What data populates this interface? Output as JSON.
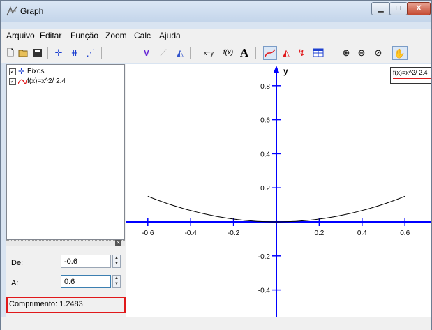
{
  "window": {
    "title": "Graph"
  },
  "menu": [
    "Arquivo",
    "Editar",
    "Função",
    "Zoom",
    "Calc",
    "Ajuda"
  ],
  "toolbar": {
    "icons": [
      "new-file-icon",
      "open-folder-icon",
      "save-icon",
      "insert-axes-icon",
      "insert-perpendicular-icon",
      "insert-point-series-icon",
      "insert-function-icon",
      "insert-tangent-icon",
      "insert-shading-icon",
      "xy-icon",
      "fx-icon",
      "text-icon",
      "trace-icon",
      "area-icon",
      "evaluate-icon",
      "table-icon",
      "zoom-in-icon",
      "zoom-out-icon",
      "zoom-standard-icon",
      "hand-icon"
    ],
    "labels": {
      "xy": "x=y",
      "fx": "f(x)",
      "text": "A"
    }
  },
  "tree": [
    {
      "label": "Eixos",
      "checked": true,
      "icon": "axes-icon"
    },
    {
      "label": "f(x)=x^2/ 2.4",
      "checked": true,
      "icon": "function-curve-icon"
    }
  ],
  "panel": {
    "from_label": "De:",
    "from_value": "-0.6",
    "to_label": "A:",
    "to_value": "0.6",
    "length_label": "Comprimento:",
    "length_value": "1.2483"
  },
  "legend": {
    "text": "f(x)=x^2/ 2.4"
  },
  "colors": {
    "axis": "#0000ff",
    "curve": "#000000",
    "highlight": "#e0191b",
    "legend_line": "#e0191b"
  },
  "graph": {
    "y_axis_label": "y",
    "x_ticks": [
      "-0.6",
      "-0.4",
      "-0.2",
      "0.2",
      "0.4",
      "0.6"
    ],
    "y_ticks": [
      "0.8",
      "0.6",
      "0.4",
      "0.2",
      "-0.2",
      "-0.4"
    ],
    "function": "x^2/2.4",
    "x_range": [
      -0.6,
      0.6
    ]
  }
}
